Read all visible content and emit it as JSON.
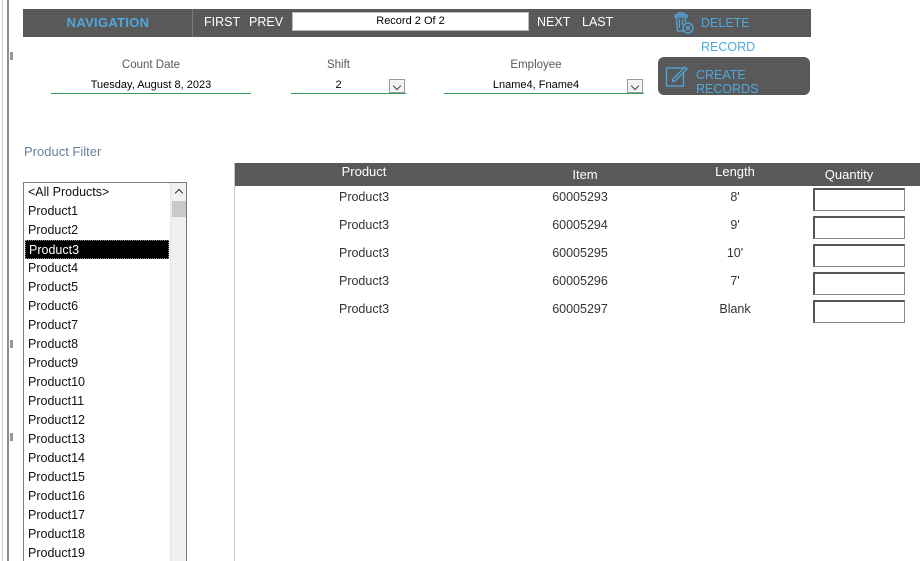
{
  "nav": {
    "title": "NAVIGATION",
    "first": "FIRST",
    "prev": "PREV",
    "record": "Record 2  Of  2",
    "next": "NEXT",
    "last": "LAST",
    "delete": "DELETE RECORD",
    "delete_icon": "trash-icon"
  },
  "header": {
    "count_date_label": "Count Date",
    "count_date": "Tuesday, August 8, 2023",
    "shift_label": "Shift",
    "shift": "2",
    "employee_label": "Employee",
    "employee": "Lname4, Fname4",
    "create": "CREATE RECORDS",
    "create_icon": "edit-icon"
  },
  "filter": {
    "title": "Product Filter",
    "items": [
      "<All Products>",
      "Product1",
      "Product2",
      "Product3",
      "Product4",
      "Product5",
      "Product6",
      "Product7",
      "Product8",
      "Product9",
      "Product10",
      "Product11",
      "Product12",
      "Product13",
      "Product14",
      "Product15",
      "Product16",
      "Product17",
      "Product18",
      "Product19"
    ],
    "selected": "Product3"
  },
  "table": {
    "columns": [
      "Product",
      "Item",
      "Length",
      "Quantity"
    ],
    "rows": [
      {
        "product": "Product3",
        "item": "60005293",
        "length": "8'",
        "quantity": ""
      },
      {
        "product": "Product3",
        "item": "60005294",
        "length": "9'",
        "quantity": ""
      },
      {
        "product": "Product3",
        "item": "60005295",
        "length": "10'",
        "quantity": ""
      },
      {
        "product": "Product3",
        "item": "60005296",
        "length": "7'",
        "quantity": ""
      },
      {
        "product": "Product3",
        "item": "60005297",
        "length": "Blank",
        "quantity": ""
      }
    ]
  },
  "colors": {
    "bar": "#595959",
    "accent": "#4fa8dc",
    "underline": "#2e9e58",
    "filter_title": "#6a7f9e"
  }
}
